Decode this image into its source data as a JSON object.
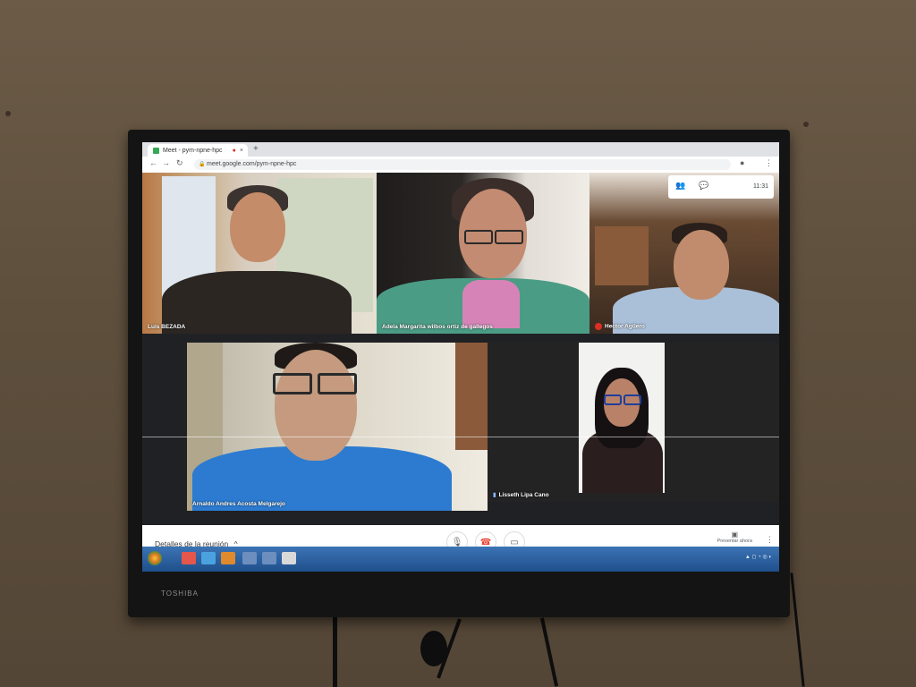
{
  "browser": {
    "tab_title": "Meet - pym-npne-hpc",
    "tab_close": "×",
    "new_tab": "+",
    "url": "meet.google.com/pym-npne-hpc"
  },
  "meet": {
    "clock": "11:31",
    "participants": [
      {
        "name": "Luis BEZADA"
      },
      {
        "name": "Adela Margarita wilbos ortiz de gallegos"
      },
      {
        "name": "Hector Agüero"
      },
      {
        "name": "Arnaldo Andres Acosta Melgarejo"
      },
      {
        "name": "Lisseth Lipa Cano"
      }
    ],
    "controls": {
      "details_label": "Detalles de la reunión",
      "present_label": "Presentar ahora"
    }
  },
  "tv": {
    "brand": "TOSHIBA"
  }
}
